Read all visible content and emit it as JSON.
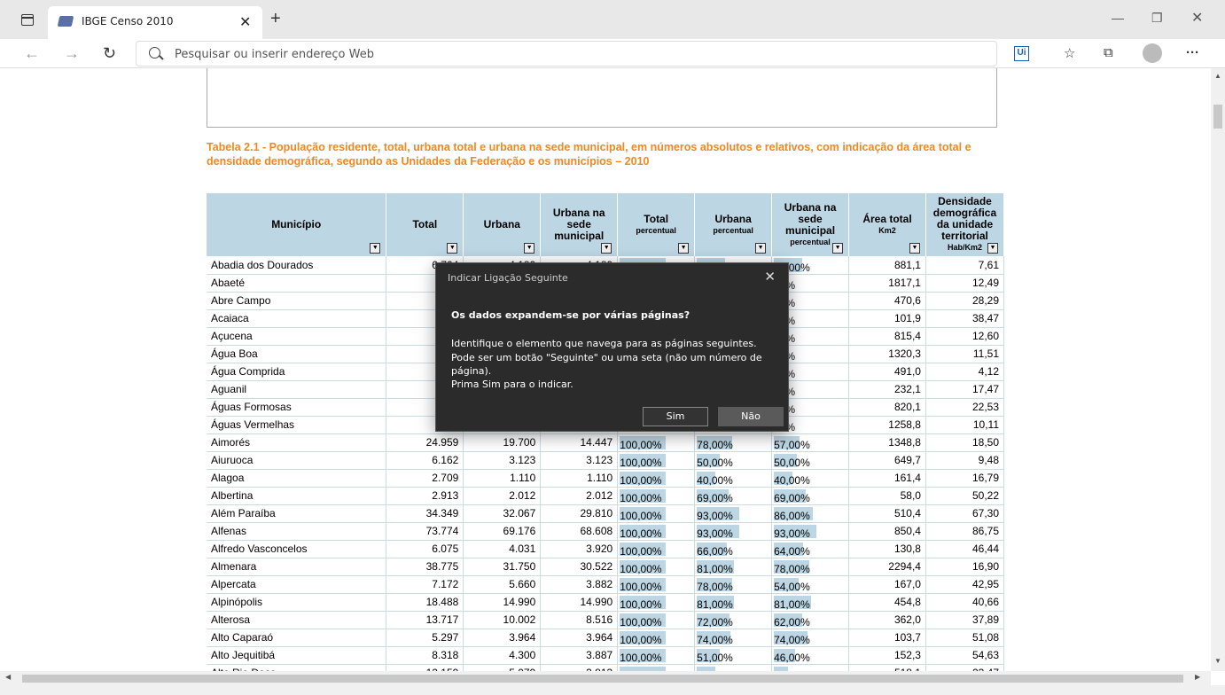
{
  "browser": {
    "tab_title": "IBGE Censo 2010",
    "address_placeholder": "Pesquisar ou inserir endereço Web"
  },
  "caption": "Tabela 2.1 - População residente, total, urbana total e urbana na sede municipal, em números absolutos e relativos, com indicação da área total e densidade demográfica, segundo as Unidades da Federação e os municípios – 2010",
  "columns": [
    {
      "label": "Município",
      "sub": ""
    },
    {
      "label": "Total",
      "sub": ""
    },
    {
      "label": "Urbana",
      "sub": ""
    },
    {
      "label": "Urbana na sede municipal",
      "sub": ""
    },
    {
      "label": "Total",
      "sub": "percentual"
    },
    {
      "label": "Urbana",
      "sub": "percentual"
    },
    {
      "label": "Urbana na sede municipal",
      "sub": "percentual"
    },
    {
      "label": "Área total",
      "sub": "Km2"
    },
    {
      "label": "Densidade demográfica da unidade territorial",
      "sub": "Hab/Km2"
    }
  ],
  "rows": [
    [
      "Abadia dos Dourados",
      "6.704",
      "4.189",
      "4.189",
      "100,00%",
      "62,00%",
      "62,00%",
      "881,1",
      "7,61"
    ],
    [
      "Abaeté",
      "22",
      "",
      "",
      "",
      "",
      "00%",
      "1817,1",
      "12,49"
    ],
    [
      "Abre Campo",
      "13",
      "",
      "",
      "",
      "",
      "00%",
      "470,6",
      "28,29"
    ],
    [
      "Acaiaca",
      "3",
      "",
      "",
      "",
      "",
      "00%",
      "101,9",
      "38,47"
    ],
    [
      "Açucena",
      "10",
      "",
      "",
      "",
      "",
      "00%",
      "815,4",
      "12,60"
    ],
    [
      "Água Boa",
      "15",
      "",
      "",
      "",
      "",
      "00%",
      "1320,3",
      "11,51"
    ],
    [
      "Água Comprida",
      "2",
      "",
      "",
      "",
      "",
      "00%",
      "491,0",
      "4,12"
    ],
    [
      "Aguanil",
      "4",
      "",
      "",
      "",
      "",
      "00%",
      "232,1",
      "17,47"
    ],
    [
      "Águas Formosas",
      "18",
      "",
      "",
      "",
      "",
      "00%",
      "820,1",
      "22,53"
    ],
    [
      "Águas Vermelhas",
      "12",
      "",
      "",
      "",
      "",
      "00%",
      "1258,8",
      "10,11"
    ],
    [
      "Aimorés",
      "24.959",
      "19.700",
      "14.447",
      "100,00%",
      "78,00%",
      "57,00%",
      "1348,8",
      "18,50"
    ],
    [
      "Aiuruoca",
      "6.162",
      "3.123",
      "3.123",
      "100,00%",
      "50,00%",
      "50,00%",
      "649,7",
      "9,48"
    ],
    [
      "Alagoa",
      "2.709",
      "1.110",
      "1.110",
      "100,00%",
      "40,00%",
      "40,00%",
      "161,4",
      "16,79"
    ],
    [
      "Albertina",
      "2.913",
      "2.012",
      "2.012",
      "100,00%",
      "69,00%",
      "69,00%",
      "58,0",
      "50,22"
    ],
    [
      "Além Paraíba",
      "34.349",
      "32.067",
      "29.810",
      "100,00%",
      "93,00%",
      "86,00%",
      "510,4",
      "67,30"
    ],
    [
      "Alfenas",
      "73.774",
      "69.176",
      "68.608",
      "100,00%",
      "93,00%",
      "93,00%",
      "850,4",
      "86,75"
    ],
    [
      "Alfredo Vasconcelos",
      "6.075",
      "4.031",
      "3.920",
      "100,00%",
      "66,00%",
      "64,00%",
      "130,8",
      "46,44"
    ],
    [
      "Almenara",
      "38.775",
      "31.750",
      "30.522",
      "100,00%",
      "81,00%",
      "78,00%",
      "2294,4",
      "16,90"
    ],
    [
      "Alpercata",
      "7.172",
      "5.660",
      "3.882",
      "100,00%",
      "78,00%",
      "54,00%",
      "167,0",
      "42,95"
    ],
    [
      "Alpinópolis",
      "18.488",
      "14.990",
      "14.990",
      "100,00%",
      "81,00%",
      "81,00%",
      "454,8",
      "40,66"
    ],
    [
      "Alterosa",
      "13.717",
      "10.002",
      "8.516",
      "100,00%",
      "72,00%",
      "62,00%",
      "362,0",
      "37,89"
    ],
    [
      "Alto Caparaó",
      "5.297",
      "3.964",
      "3.964",
      "100,00%",
      "74,00%",
      "74,00%",
      "103,7",
      "51,08"
    ],
    [
      "Alto Jequitibá",
      "8.318",
      "4.300",
      "3.887",
      "100,00%",
      "51,00%",
      "46,00%",
      "152,3",
      "54,63"
    ],
    [
      "Alto Rio Doce",
      "12.159",
      "5.079",
      "3.813",
      "100,00%",
      "41,00%",
      "31,00%",
      "518,1",
      "23,47"
    ]
  ],
  "dialog": {
    "title": "Indicar Ligação Seguinte",
    "question": "Os dados expandem-se por várias páginas?",
    "body": "Identifique o elemento que navega para as páginas seguintes. Pode ser um botão \"Seguinte\" ou uma seta (não um número de página).",
    "prompt": "Prima Sim para o indicar.",
    "yes_label": "Sim",
    "no_label": "Não"
  }
}
